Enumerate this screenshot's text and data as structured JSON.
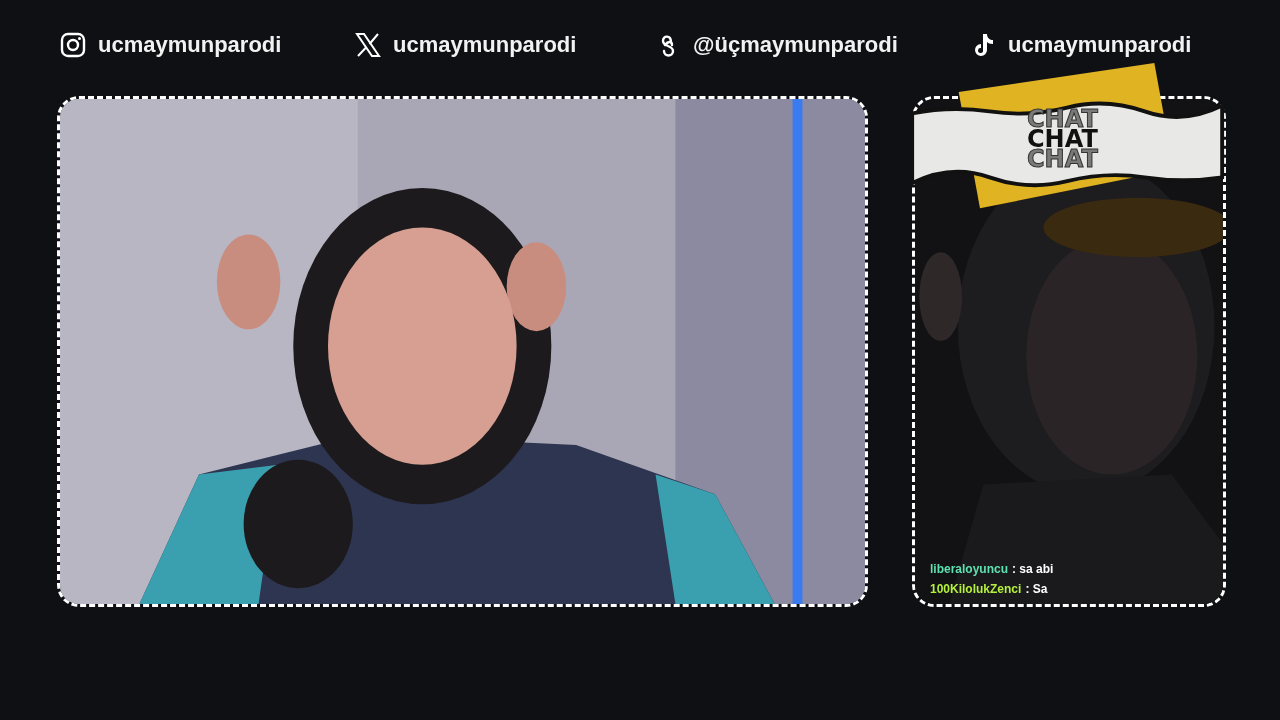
{
  "socials": [
    {
      "kind": "camera",
      "handle": "ucmaymunparodi"
    },
    {
      "kind": "cross",
      "handle": "ucmaymunparodi"
    },
    {
      "kind": "swirl",
      "handle": "@üçmaymunparodi"
    },
    {
      "kind": "note",
      "handle": "ucmaymunparodi"
    }
  ],
  "chat": {
    "title": [
      {
        "text": "CHAT",
        "kind": "outline"
      },
      {
        "text": "CHAT",
        "kind": "solid"
      },
      {
        "text": "CHAT",
        "kind": "outline"
      }
    ],
    "messages": [
      {
        "user": "liberaloyuncu",
        "color": "#5fe0b0",
        "text": ": sa abi"
      },
      {
        "user": "100KilolukZenci",
        "color": "#b4f03c",
        "text": ": Sa"
      }
    ]
  }
}
